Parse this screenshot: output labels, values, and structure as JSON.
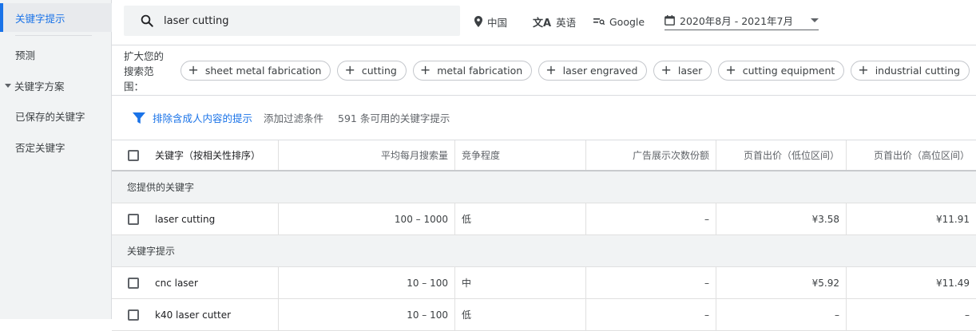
{
  "sidebar": {
    "items": [
      {
        "label": "关键字提示",
        "active": true
      },
      {
        "label": "预测"
      },
      {
        "label": "关键字方案"
      },
      {
        "label": "已保存的关键字"
      },
      {
        "label": "否定关键字"
      }
    ]
  },
  "search": {
    "value": "laser cutting"
  },
  "top_options": {
    "location": "中国",
    "language": "英语",
    "network": "Google",
    "date_range": "2020年8月 - 2021年7月"
  },
  "expand": {
    "label": "扩大您的搜索范围：",
    "chips": [
      "sheet metal fabrication",
      "cutting",
      "metal fabrication",
      "laser engraved",
      "laser",
      "cutting equipment",
      "industrial cutting"
    ]
  },
  "filters": {
    "exclude_adult": "排除含成人内容的提示",
    "add_filter": "添加过滤条件",
    "count_text": "591 条可用的关键字提示"
  },
  "table": {
    "headers": {
      "keyword": "关键字（按相关性排序）",
      "volume": "平均每月搜索量",
      "competition": "竞争程度",
      "impression_share": "广告展示次数份额",
      "bid_low": "页首出价（低位区间）",
      "bid_high": "页首出价（高位区间）"
    },
    "groups": [
      {
        "label": "您提供的关键字",
        "rows": [
          {
            "keyword": "laser cutting",
            "volume": "100 – 1000",
            "competition": "低",
            "impression_share": "–",
            "bid_low": "¥3.58",
            "bid_high": "¥11.91"
          }
        ]
      },
      {
        "label": "关键字提示",
        "rows": [
          {
            "keyword": "cnc laser",
            "volume": "10 – 100",
            "competition": "中",
            "impression_share": "–",
            "bid_low": "¥5.92",
            "bid_high": "¥11.49"
          },
          {
            "keyword": "k40 laser cutter",
            "volume": "10 – 100",
            "competition": "低",
            "impression_share": "–",
            "bid_low": "–",
            "bid_high": "–"
          }
        ]
      }
    ]
  },
  "colors": {
    "accent": "#1a73e8",
    "sidebar_bg": "#f1f3f4"
  }
}
